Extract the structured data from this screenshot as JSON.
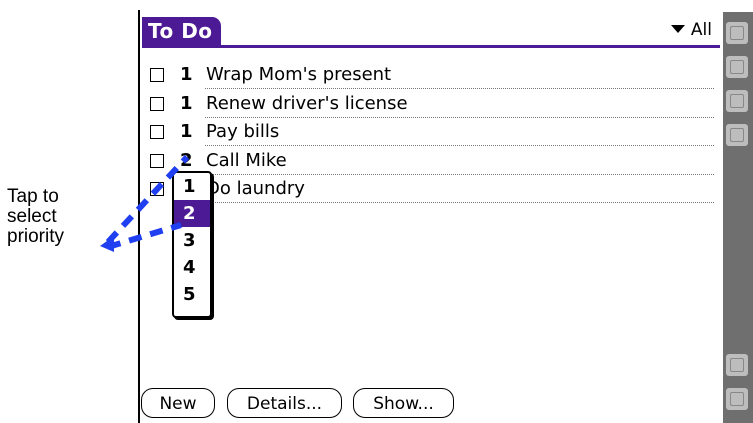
{
  "window": {
    "title": "To Do",
    "category": "All"
  },
  "tasks": [
    {
      "priority": "1",
      "description": "Wrap Mom's present",
      "checked": false
    },
    {
      "priority": "1",
      "description": "Renew driver's license",
      "checked": false
    },
    {
      "priority": "1",
      "description": "Pay bills",
      "checked": false
    },
    {
      "priority": "2",
      "description": "Call Mike",
      "checked": false
    },
    {
      "priority": "",
      "description": "Do laundry",
      "checked": true
    }
  ],
  "priority_popup": {
    "options": [
      "1",
      "2",
      "3",
      "4",
      "5"
    ],
    "selected": "2"
  },
  "buttons": {
    "new": "New",
    "details": "Details...",
    "show": "Show..."
  },
  "callout": {
    "line1": "Tap to",
    "line2": "select",
    "line3": "priority"
  },
  "colors": {
    "accent": "#4b1a94",
    "annotation": "#1f3ff0",
    "sidebar": "#6f6f6f"
  },
  "sidebar_icons": [
    "home-icon",
    "menu-icon",
    "find-icon",
    "speaker-icon",
    "scroll-up-icon",
    "scroll-down-icon"
  ]
}
